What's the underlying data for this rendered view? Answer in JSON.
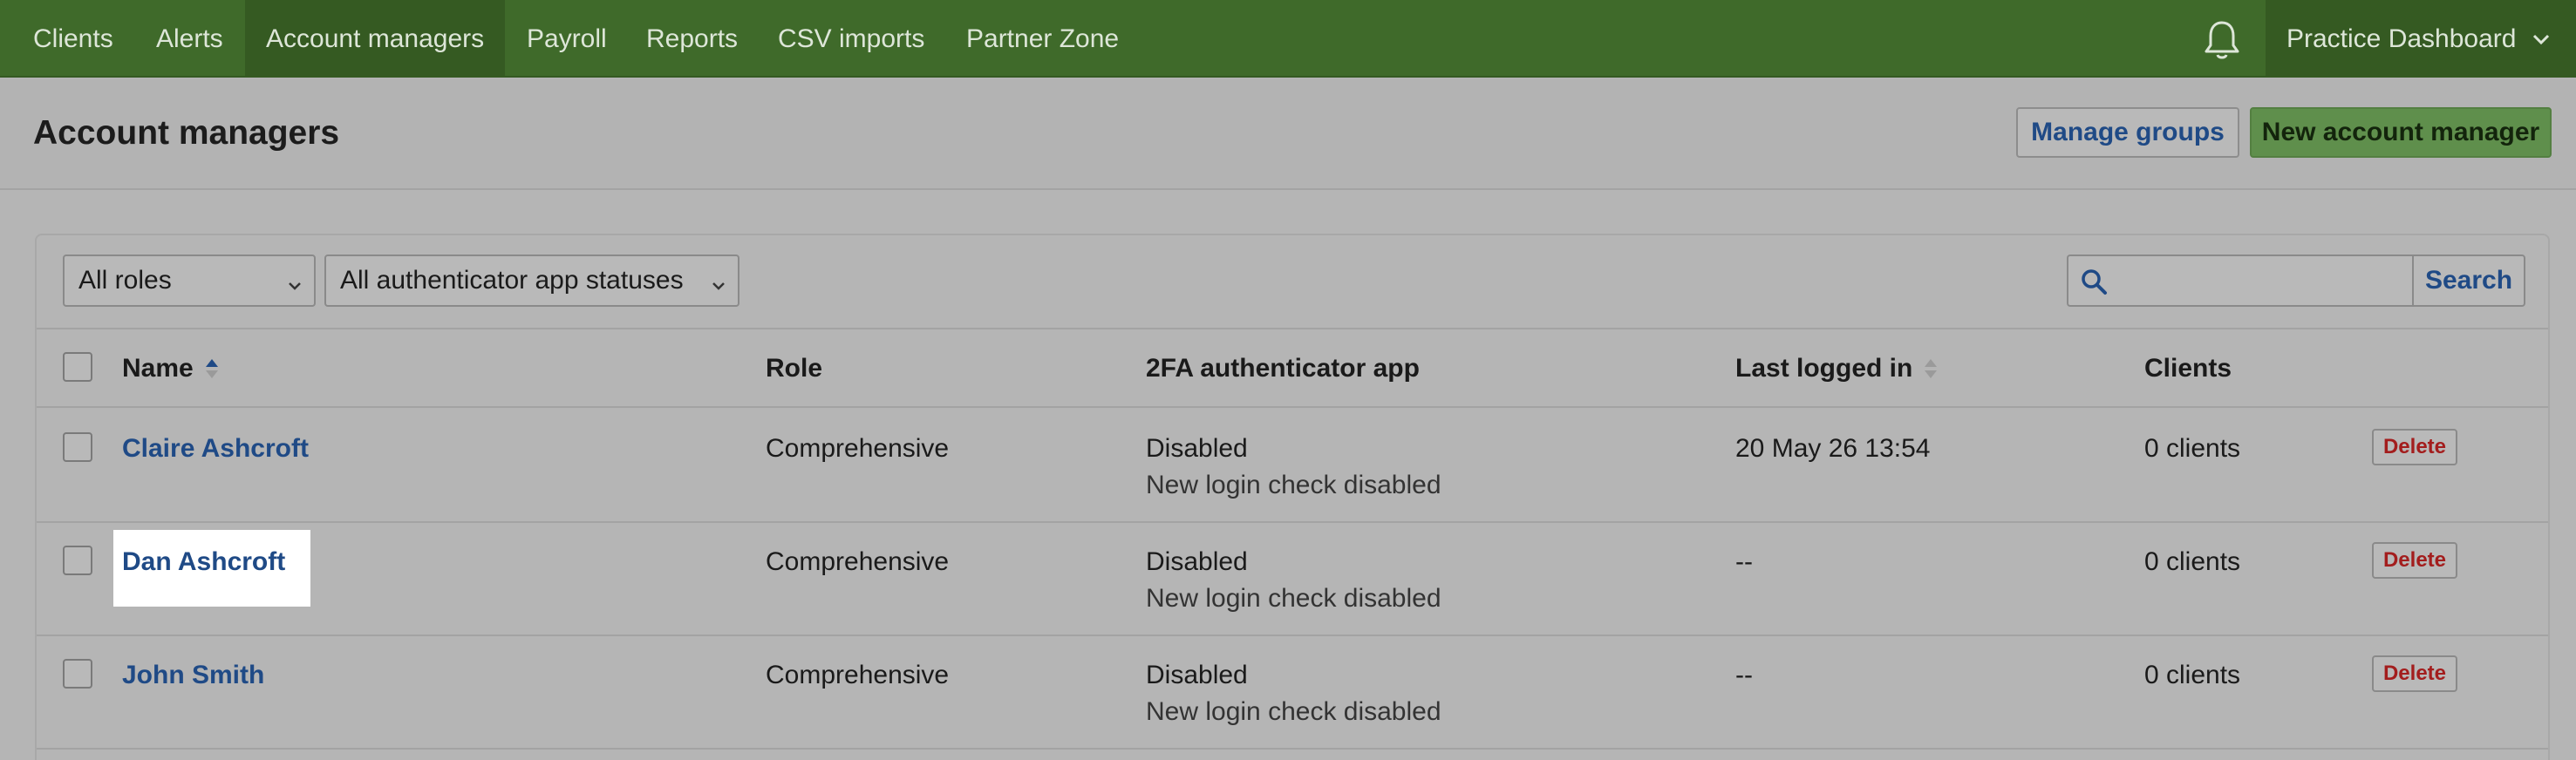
{
  "nav": {
    "items": [
      {
        "label": "Clients"
      },
      {
        "label": "Alerts"
      },
      {
        "label": "Account managers"
      },
      {
        "label": "Payroll"
      },
      {
        "label": "Reports"
      },
      {
        "label": "CSV imports"
      },
      {
        "label": "Partner Zone"
      }
    ],
    "active": "Account managers",
    "practice_label": "Practice Dashboard"
  },
  "header": {
    "title": "Account managers",
    "manage_groups_label": "Manage groups",
    "new_manager_label": "New account manager"
  },
  "filters": {
    "role_value": "All roles",
    "auth_value": "All authenticator app statuses",
    "search_placeholder": "",
    "search_label": "Search"
  },
  "table": {
    "columns": {
      "name": "Name",
      "role": "Role",
      "twofa": "2FA authenticator app",
      "last_logged": "Last logged in",
      "clients": "Clients"
    },
    "rows": [
      {
        "name": "Claire Ashcroft",
        "role": "Comprehensive",
        "twofa": "Disabled",
        "twofa_sub": "New login check disabled",
        "last_logged": "20 May 26 13:54",
        "clients": "0 clients",
        "delete": "Delete"
      },
      {
        "name": "Dan Ashcroft",
        "role": "Comprehensive",
        "twofa": "Disabled",
        "twofa_sub": "New login check disabled",
        "last_logged": "--",
        "clients": "0 clients",
        "delete": "Delete"
      },
      {
        "name": "John Smith",
        "role": "Comprehensive",
        "twofa": "Disabled",
        "twofa_sub": "New login check disabled",
        "last_logged": "--",
        "clients": "0 clients",
        "delete": "Delete"
      }
    ]
  },
  "icons": {
    "bell": "bell-icon",
    "chevron": "chevron-down-icon",
    "search": "search-icon",
    "sort_active": "sort-asc-icon",
    "sort_inactive": "sort-icon"
  },
  "colors": {
    "nav_bg": "#3f6a2a",
    "link": "#1f4a86",
    "primary_btn": "#5f8f4c",
    "delete": "#a31d1d"
  }
}
